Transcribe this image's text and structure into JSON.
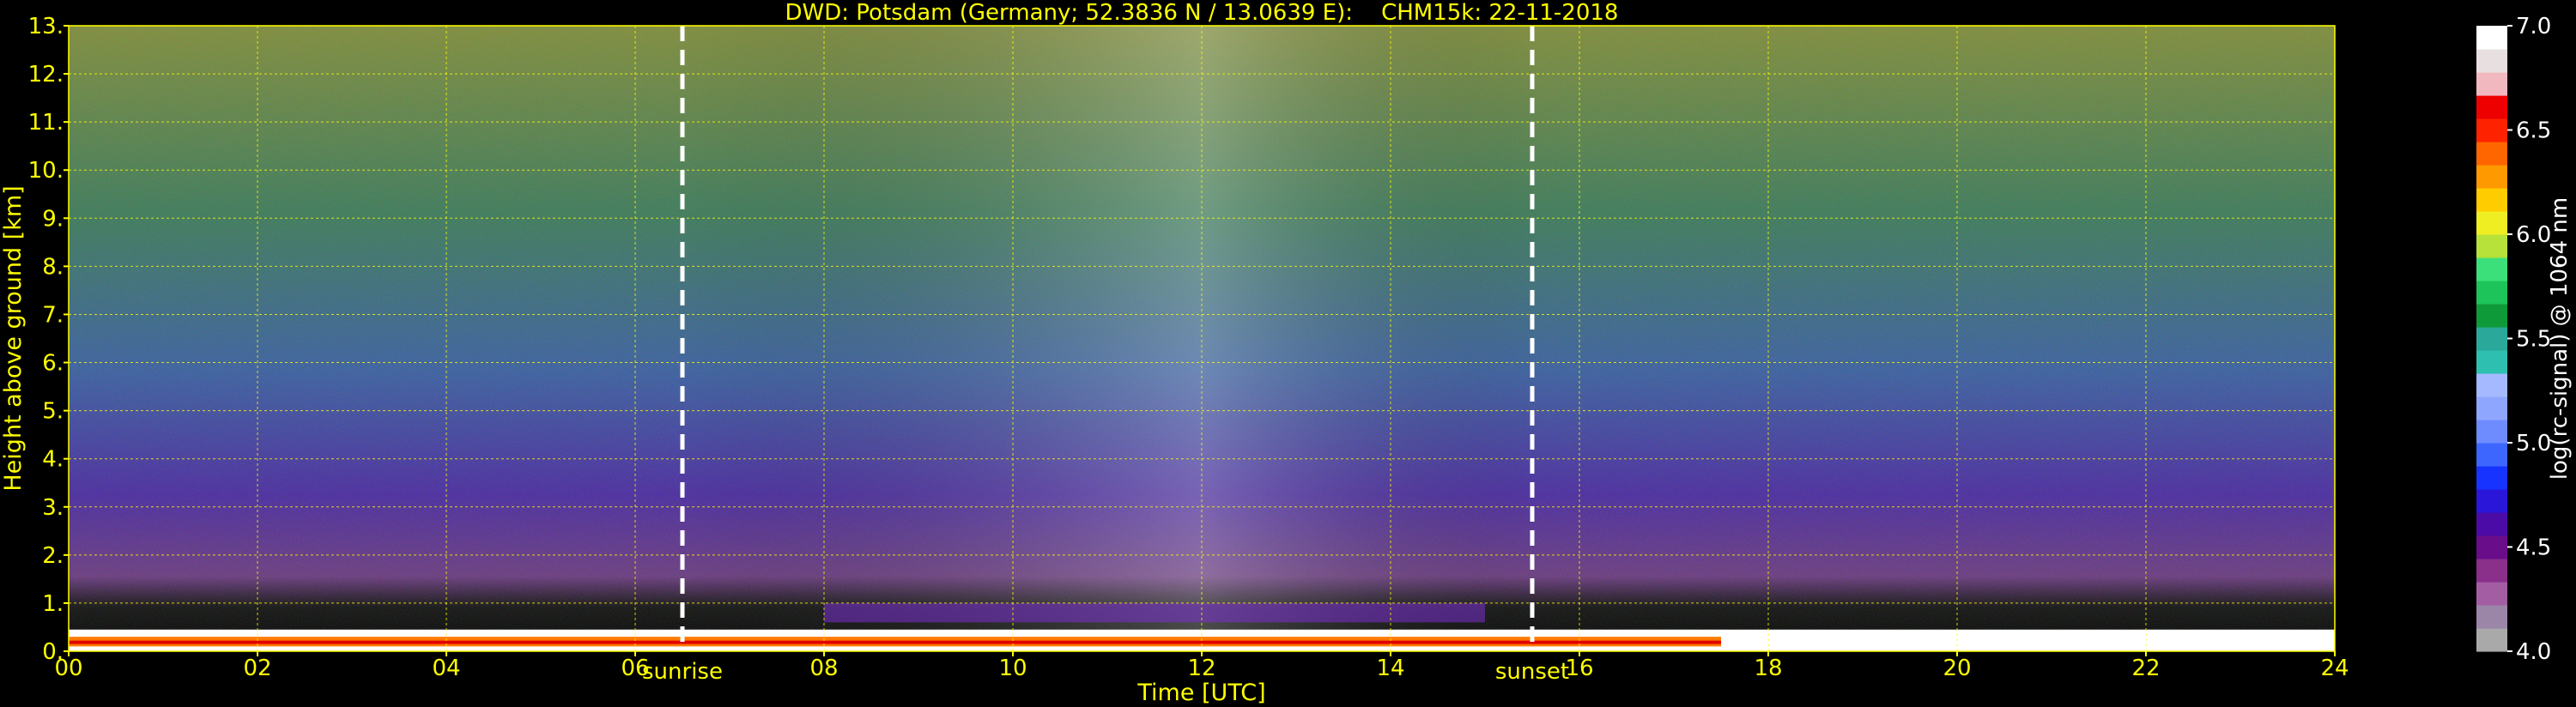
{
  "title": "DWD: Potsdam (Germany; 52.3836 N / 13.0639 E):    CHM15k: 22-11-2018",
  "chart_data": {
    "type": "heatmap",
    "xlabel": "Time [UTC]",
    "ylabel": "Height above ground [km]",
    "xlim": [
      0,
      24
    ],
    "ylim": [
      0,
      13
    ],
    "x_ticks": [
      "00",
      "02",
      "04",
      "06",
      "08",
      "10",
      "12",
      "14",
      "16",
      "18",
      "20",
      "22",
      "24"
    ],
    "y_ticks": [
      "0.",
      "1.",
      "2.",
      "3.",
      "4.",
      "5.",
      "6.",
      "7.",
      "8.",
      "9.",
      "10.",
      "11.",
      "12.",
      "13."
    ],
    "grid": true,
    "markers": [
      {
        "label": "sunrise",
        "x": 6.5
      },
      {
        "label": "sunset",
        "x": 15.5
      }
    ],
    "colorbar": {
      "label": "log(rc-signal) @ 1064 nm",
      "range": [
        4.0,
        7.0
      ],
      "ticks": [
        "4.0",
        "4.5",
        "5.0",
        "5.5",
        "6.0",
        "6.5",
        "7.0"
      ],
      "colors": [
        "#a9a9a9",
        "#9b86a8",
        "#a35ea3",
        "#8a2f8a",
        "#6a0d8a",
        "#4b0ba6",
        "#2a16d8",
        "#1633ff",
        "#3d66ff",
        "#6f8cff",
        "#8fa6ff",
        "#a4b9ff",
        "#2fbfb0",
        "#2aa99a",
        "#0f9a3a",
        "#1cc45a",
        "#3ce07a",
        "#b6e23a",
        "#eeee22",
        "#ffcc00",
        "#ff9900",
        "#ff6600",
        "#ff2200",
        "#ee0000",
        "#f2b8c0",
        "#e8e0e0",
        "#ffffff"
      ]
    }
  }
}
